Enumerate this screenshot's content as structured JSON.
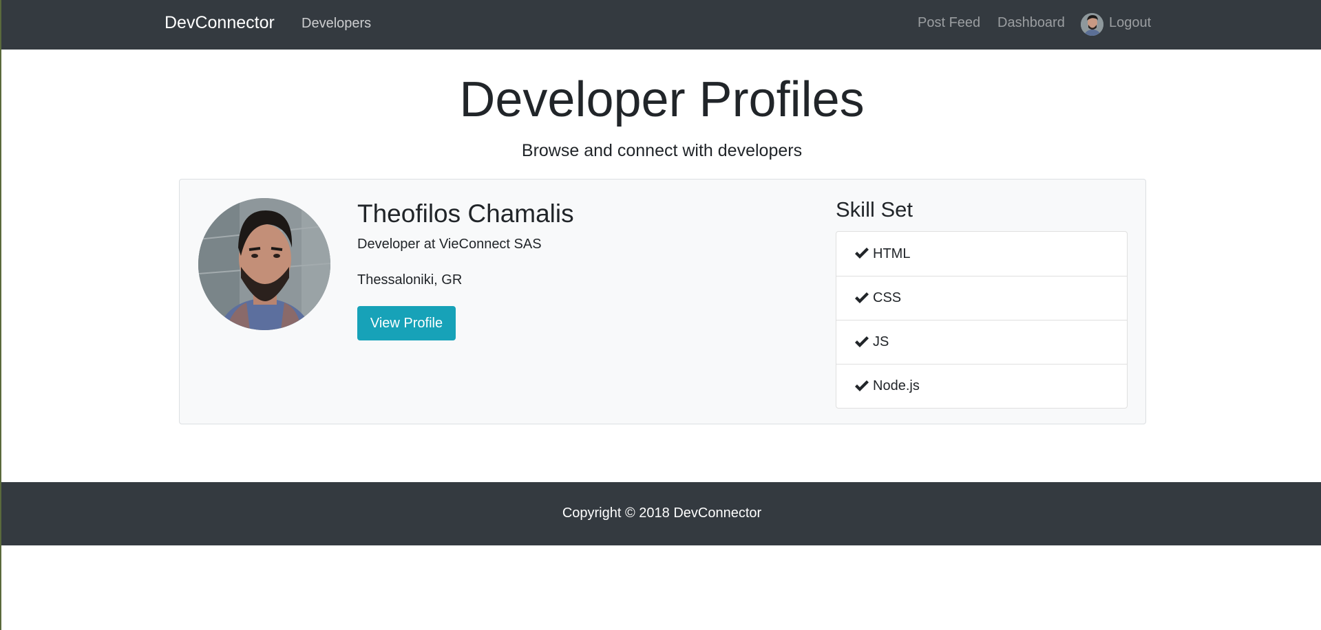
{
  "navbar": {
    "brand": "DevConnector",
    "developers_link": "Developers",
    "post_feed_link": "Post Feed",
    "dashboard_link": "Dashboard",
    "logout_link": "Logout",
    "avatar_icon": "user-avatar-icon"
  },
  "header": {
    "title": "Developer Profiles",
    "lead": "Browse and connect with developers"
  },
  "profiles": [
    {
      "name": "Theofilos Chamalis",
      "job": "Developer at VieConnect SAS",
      "location": "Thessaloniki, GR",
      "view_button": "View Profile",
      "skills_title": "Skill Set",
      "skills": [
        "HTML",
        "CSS",
        "JS",
        "Node.js"
      ]
    }
  ],
  "footer": {
    "copyright": "Copyright © 2018 DevConnector"
  },
  "colors": {
    "navbar_bg": "#343a40",
    "button_info": "#17a2b8",
    "card_bg": "#f8f9fa"
  }
}
